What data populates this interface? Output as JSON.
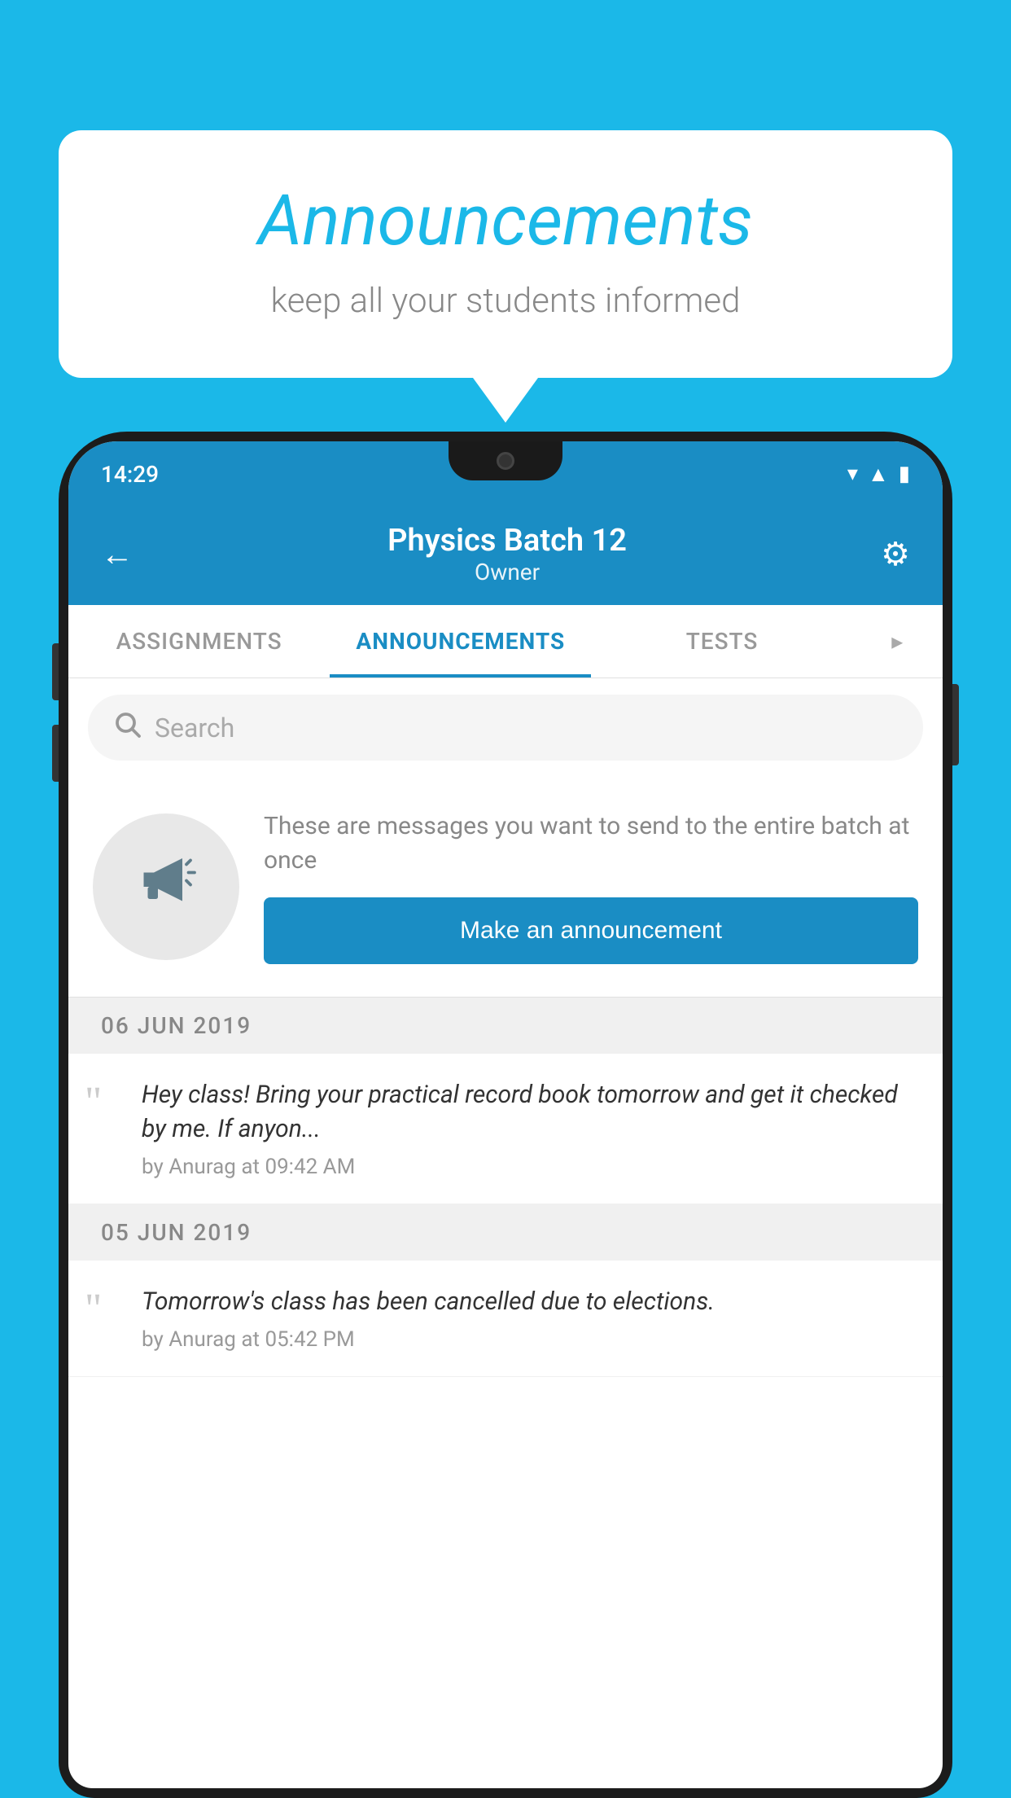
{
  "background_color": "#1bb8e8",
  "speech_bubble": {
    "title": "Announcements",
    "subtitle": "keep all your students informed"
  },
  "phone": {
    "status_bar": {
      "time": "14:29"
    },
    "header": {
      "back_label": "←",
      "title": "Physics Batch 12",
      "subtitle": "Owner",
      "settings_label": "⚙"
    },
    "tabs": [
      {
        "label": "ASSIGNMENTS",
        "active": false
      },
      {
        "label": "ANNOUNCEMENTS",
        "active": true
      },
      {
        "label": "TESTS",
        "active": false
      },
      {
        "label": "...",
        "active": false
      }
    ],
    "search": {
      "placeholder": "Search"
    },
    "announcement_prompt": {
      "description": "These are messages you want to send to the entire batch at once",
      "button_label": "Make an announcement"
    },
    "messages": [
      {
        "date": "06  JUN  2019",
        "items": [
          {
            "text": "Hey class! Bring your practical record book tomorrow and get it checked by me. If anyon...",
            "author": "by Anurag at 09:42 AM"
          }
        ]
      },
      {
        "date": "05  JUN  2019",
        "items": [
          {
            "text": "Tomorrow's class has been cancelled due to elections.",
            "author": "by Anurag at 05:42 PM"
          }
        ]
      }
    ]
  }
}
